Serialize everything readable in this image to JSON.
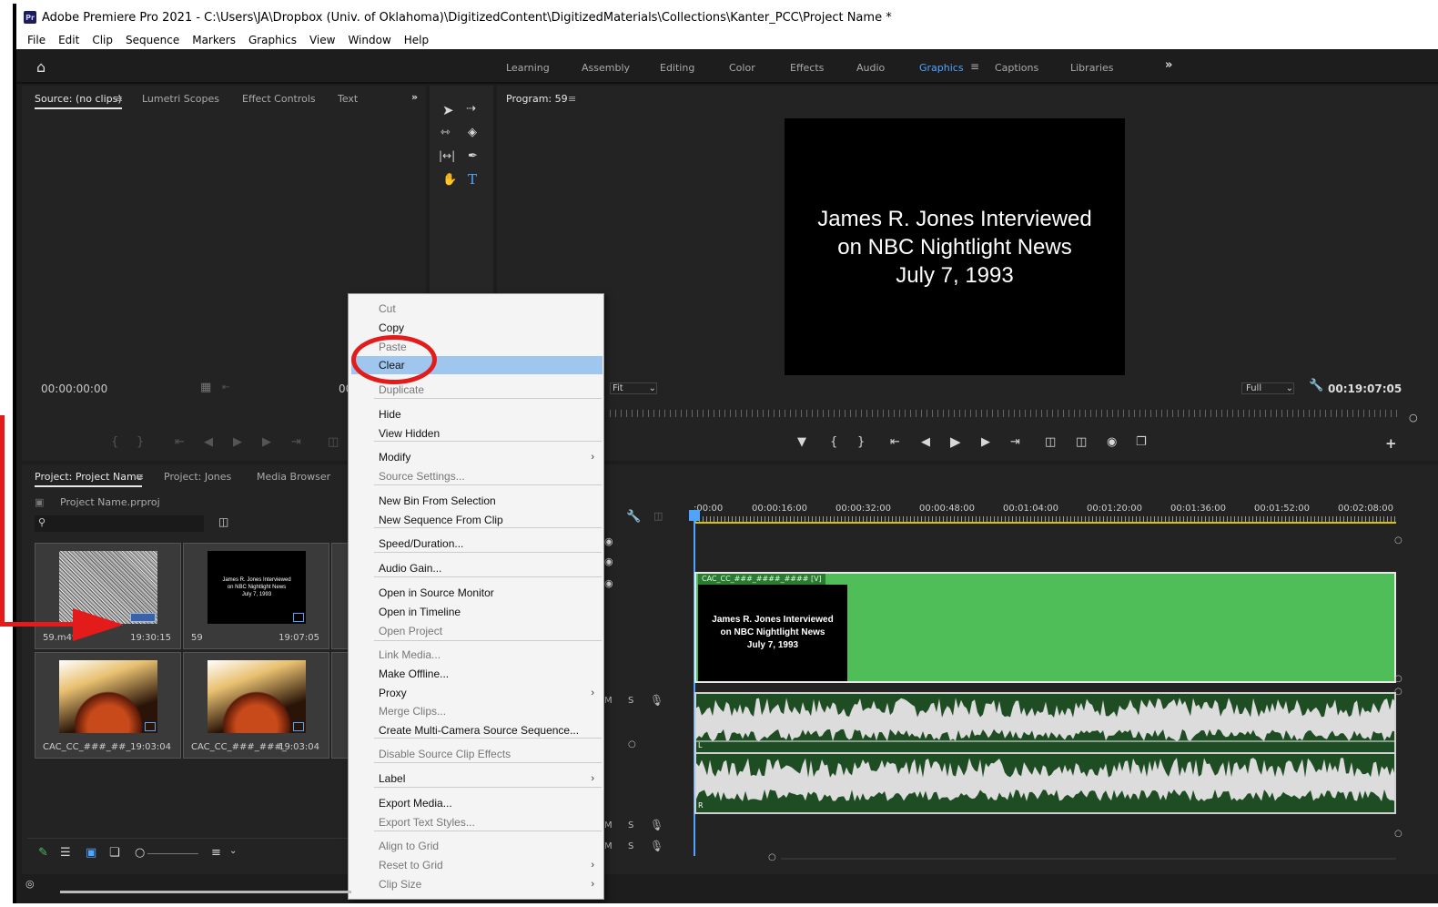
{
  "window": {
    "logo_text": "Pr",
    "title": "Adobe Premiere Pro 2021 - C:\\Users\\JA\\Dropbox (Univ. of Oklahoma)\\DigitizedContent\\DigitizedMaterials\\Collections\\Kanter_PCC\\Project Name *"
  },
  "menu": [
    "File",
    "Edit",
    "Clip",
    "Sequence",
    "Markers",
    "Graphics",
    "View",
    "Window",
    "Help"
  ],
  "workspaces": {
    "tabs": [
      "Learning",
      "Assembly",
      "Editing",
      "Color",
      "Effects",
      "Audio",
      "Graphics",
      "Captions",
      "Libraries"
    ],
    "active": "Graphics",
    "menu_icon": "≡",
    "more": "»"
  },
  "source_panel": {
    "tabs": [
      "Source: (no clips)",
      "Lumetri Scopes",
      "Effect Controls",
      "Text"
    ],
    "menu_icon": "≡",
    "more": "»",
    "timecode": "00:00:00:00",
    "partial_timecode": "00"
  },
  "program_panel": {
    "title": "Program: 59",
    "menu_icon": "≡",
    "title_lines": [
      "James R. Jones Interviewed",
      "on NBC Nightlight News",
      "July 7, 1993"
    ],
    "fit_value": "Fit",
    "quality_value": "Full",
    "timecode": "00:19:07:05"
  },
  "project_panel": {
    "tabs": [
      "Project: Project Name",
      "Project: Jones",
      "Media Browser"
    ],
    "menu_icon": "≡",
    "file": "Project Name.prproj",
    "items": [
      {
        "name": "59.m4v",
        "duration": "19:30:15",
        "kind": "noise"
      },
      {
        "name": "59",
        "duration": "19:07:05",
        "kind": "title"
      },
      {
        "name": "CAC_CC_###_##_",
        "duration": "19:03:04",
        "kind": "fire"
      },
      {
        "name": "CAC_CC_###_###_",
        "duration": "19:03:04",
        "kind": "fire"
      }
    ],
    "thumb_title": [
      "James R. Jones Interviewed",
      "on NBC Nightlight News",
      "July 7, 1993"
    ]
  },
  "context_menu": {
    "items": [
      {
        "label": "Cut",
        "state": "dim"
      },
      {
        "label": "Copy",
        "state": "normal"
      },
      {
        "label": "Paste",
        "state": "dim"
      },
      {
        "label": "Clear",
        "state": "highlighted"
      },
      {
        "label": "Duplicate",
        "state": "dim"
      },
      {
        "label": "Hide",
        "state": "normal"
      },
      {
        "label": "View Hidden",
        "state": "normal"
      },
      {
        "label": "Modify",
        "state": "normal",
        "submenu": true
      },
      {
        "label": "Source Settings...",
        "state": "dim"
      },
      {
        "label": "New Bin From Selection",
        "state": "normal"
      },
      {
        "label": "New Sequence From Clip",
        "state": "normal"
      },
      {
        "label": "Speed/Duration...",
        "state": "normal"
      },
      {
        "label": "Audio Gain...",
        "state": "normal"
      },
      {
        "label": "Open in Source Monitor",
        "state": "normal"
      },
      {
        "label": "Open in Timeline",
        "state": "normal"
      },
      {
        "label": "Open Project",
        "state": "dim"
      },
      {
        "label": "Link Media...",
        "state": "dim"
      },
      {
        "label": "Make Offline...",
        "state": "normal"
      },
      {
        "label": "Proxy",
        "state": "normal",
        "submenu": true
      },
      {
        "label": "Merge Clips...",
        "state": "dim"
      },
      {
        "label": "Create Multi-Camera Source Sequence...",
        "state": "normal"
      },
      {
        "label": "Disable Source Clip Effects",
        "state": "dim"
      },
      {
        "label": "Label",
        "state": "normal",
        "submenu": true
      },
      {
        "label": "Export Media...",
        "state": "normal"
      },
      {
        "label": "Export Text Styles...",
        "state": "dim"
      },
      {
        "label": "Align to Grid",
        "state": "dim"
      },
      {
        "label": "Reset to Grid",
        "state": "dim",
        "submenu": true
      },
      {
        "label": "Clip Size",
        "state": "dim",
        "submenu": true
      }
    ],
    "submenu_glyph": "›"
  },
  "timeline": {
    "ticks": [
      ":00:00",
      "00:00:16:00",
      "00:00:32:00",
      "00:00:48:00",
      "00:01:04:00",
      "00:01:20:00",
      "00:01:36:00",
      "00:01:52:00",
      "00:02:08:00"
    ],
    "clip_label": "CAC_CC_###_####_#### [V]",
    "clip_title": [
      "James R. Jones Interviewed",
      "on NBC Nightlight News",
      "July 7, 1993"
    ],
    "track_m": "M",
    "track_s": "S",
    "track_a1": "L",
    "track_a2": "R"
  },
  "colors": {
    "accent": "#4fa4ff",
    "highlight": "#9ec6ef",
    "annotation_red": "#e31b1b",
    "clip_green": "#4fbe58",
    "panel_bg": "#232323"
  },
  "icons": [
    "home-icon",
    "selection-tool-icon",
    "track-select-icon",
    "ripple-edit-icon",
    "razor-icon",
    "slip-icon",
    "pen-icon",
    "hand-icon",
    "type-icon",
    "search-icon",
    "wrench-icon",
    "play-icon",
    "camera-icon",
    "pencil-icon",
    "list-view-icon",
    "icon-view-icon",
    "sort-icon"
  ]
}
